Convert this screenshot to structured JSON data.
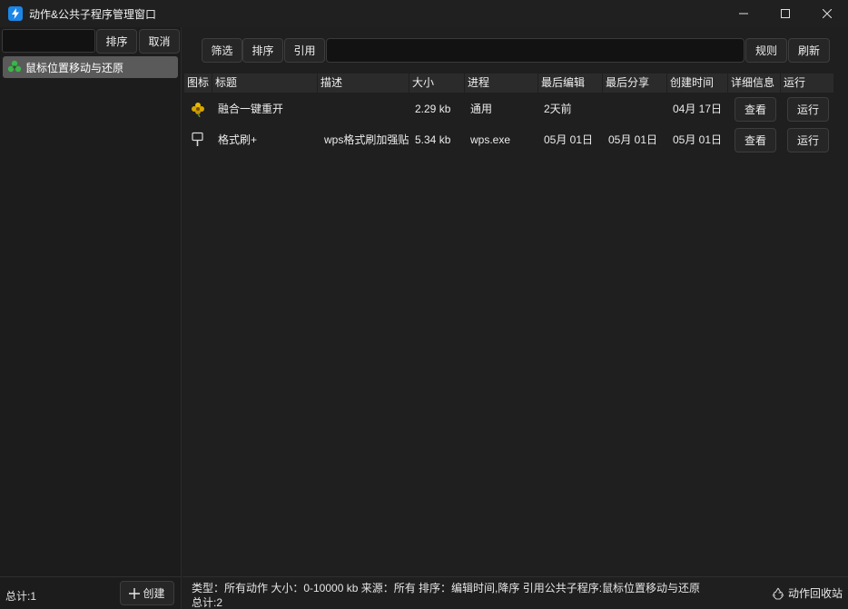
{
  "window": {
    "title": "动作&公共子程序管理窗口",
    "icon": "lightning-app-icon",
    "accent": "#1b86e8"
  },
  "sidebar": {
    "search_value": "",
    "sort_label": "排序",
    "cancel_label": "取消",
    "items": [
      {
        "label": "鼠标位置移动与还原",
        "icon": "shared-group-icon",
        "icon_color": "#3bb54a"
      }
    ],
    "total": "总计:1",
    "create_label": "创建"
  },
  "toolbar": {
    "filter_label": "筛选",
    "sort_label": "排序",
    "reference_label": "引用",
    "search_value": "",
    "rules_label": "规则",
    "refresh_label": "刷新"
  },
  "table": {
    "columns": [
      "图标",
      "标题",
      "描述",
      "大小",
      "进程",
      "最后编辑",
      "最后分享",
      "创建时间",
      "详细信息",
      "运行"
    ],
    "rows": [
      {
        "icon": "yellow-flower-icon",
        "title": "融合一键重开",
        "desc": "",
        "size": "2.29 kb",
        "process": "通用",
        "last_edit": "2天前",
        "last_share": "",
        "created": "04月 17日",
        "detail": "查看",
        "run": "运行"
      },
      {
        "icon": "brush-icon",
        "title": "格式刷+",
        "desc": "wps格式刷加强贴",
        "size": "5.34 kb",
        "process": "wps.exe",
        "last_edit": "05月 01日",
        "last_share": "05月 01日",
        "created": "05月 01日",
        "detail": "查看",
        "run": "运行"
      }
    ]
  },
  "status": {
    "line1": "类型：所有动作   大小：0-10000 kb   来源：所有   排序：编辑时间,降序   引用公共子程序:鼠标位置移动与还原",
    "line2": "总计:2",
    "recycle_label": "动作回收站"
  }
}
